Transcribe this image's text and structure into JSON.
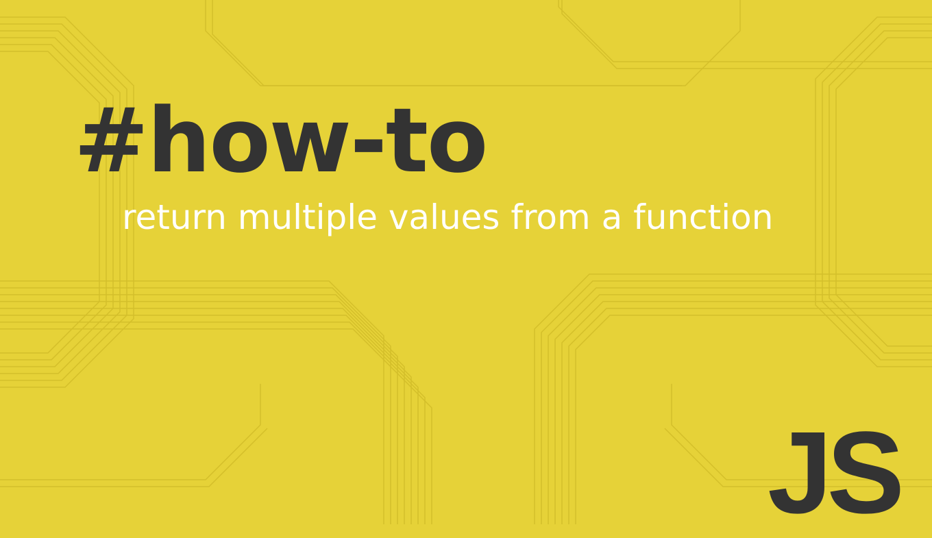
{
  "hashtag": "#how-to",
  "subtitle": "return multiple values from a function",
  "badge": "JS",
  "colors": {
    "background": "#e6d238",
    "text_dark": "#333333",
    "text_light": "#ffffff",
    "circuit": "#d4c02e"
  }
}
